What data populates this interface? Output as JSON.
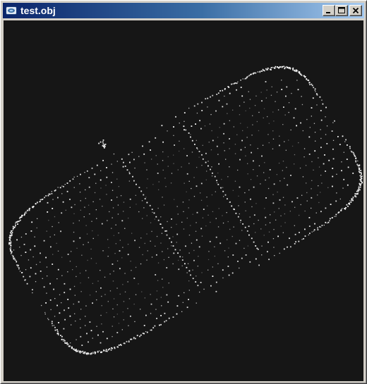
{
  "window": {
    "title": "test.obj",
    "icon": "app-window-icon",
    "controls": {
      "minimize_icon": "minimize-icon",
      "maximize_icon": "maximize-icon",
      "close_icon": "close-icon"
    }
  },
  "viewport": {
    "background_color": "#161616",
    "point_color": "#ffffff",
    "content": "point-cloud-car-model"
  }
}
